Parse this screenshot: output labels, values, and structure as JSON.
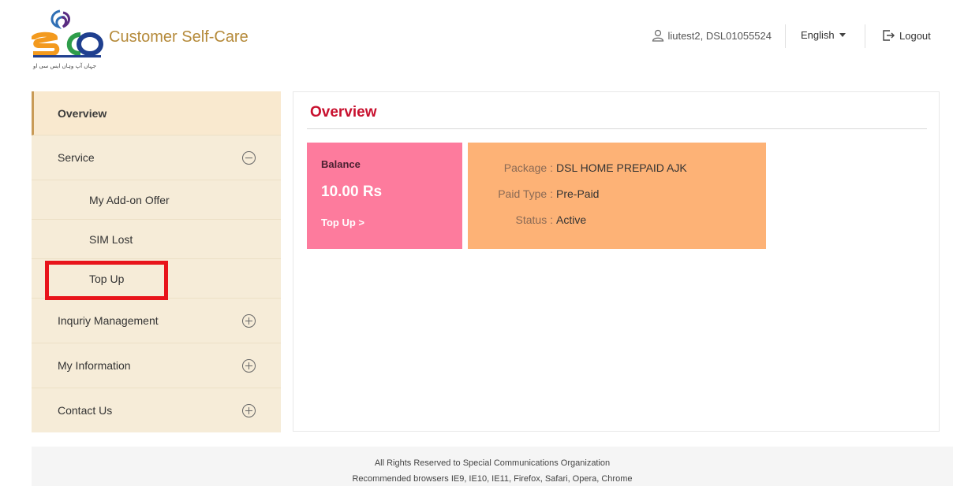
{
  "header": {
    "brand": "Customer Self-Care",
    "logo_text": "SCO",
    "user": "liutest2, DSL01055524",
    "language": "English",
    "logout": "Logout"
  },
  "sidebar": {
    "items": [
      {
        "label": "Overview"
      },
      {
        "label": "Service"
      },
      {
        "label": "My Add-on Offer"
      },
      {
        "label": "SIM Lost"
      },
      {
        "label": "Top Up"
      },
      {
        "label": "Inquriy Management"
      },
      {
        "label": "My Information"
      },
      {
        "label": "Contact Us"
      }
    ]
  },
  "main": {
    "title": "Overview",
    "balance": {
      "label": "Balance",
      "amount": "10.00 Rs",
      "topup": "Top Up >"
    },
    "package": {
      "package_key": "Package :",
      "package_val": "DSL HOME PREPAID AJK",
      "paid_key": "Paid Type :",
      "paid_val": "Pre-Paid",
      "status_key": "Status :",
      "status_val": "Active"
    }
  },
  "footer": {
    "line1": "All Rights Reserved to Special Communications Organization",
    "line2": "Recommended browsers IE9, IE10, IE11, Firefox, Safari, Opera, Chrome"
  },
  "colors": {
    "brand": "#b58a3a",
    "accent_red": "#c8102e",
    "balance_card": "#fd7b9d",
    "package_card": "#fdb276",
    "sidebar_bg": "#f6ecd8",
    "highlight": "#e8141b"
  }
}
